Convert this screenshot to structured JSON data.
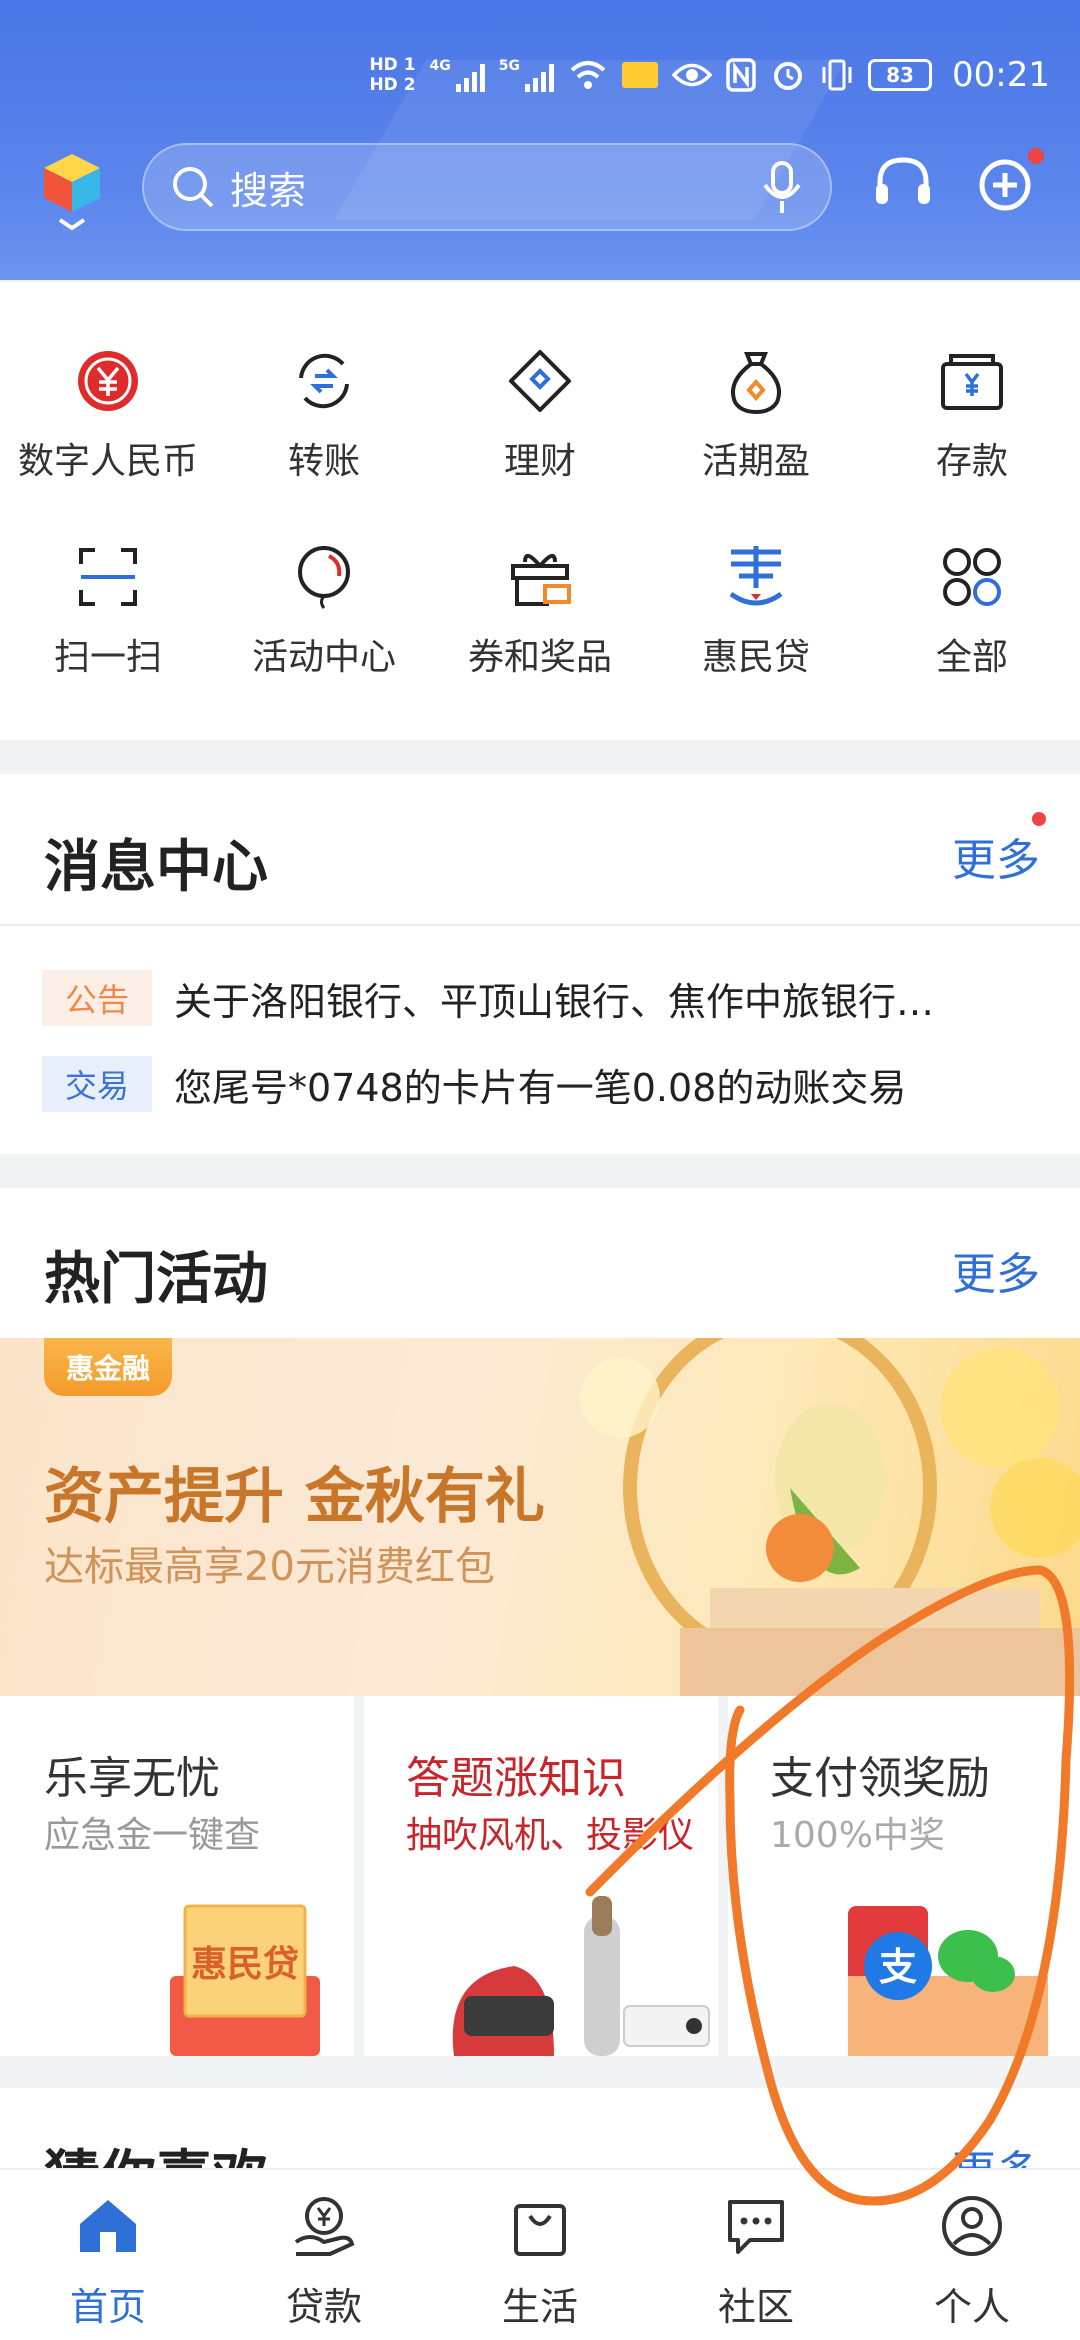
{
  "status_bar": {
    "hd1": "HD 1",
    "hd2": "HD 2",
    "net1": "4G",
    "net2": "5G",
    "battery": "83",
    "time": "00:21"
  },
  "header": {
    "search_placeholder": "搜索"
  },
  "quick_actions": [
    {
      "label": "数字人民币",
      "icon": "digital-rmb-icon"
    },
    {
      "label": "转账",
      "icon": "transfer-icon"
    },
    {
      "label": "理财",
      "icon": "wealth-diamond-icon"
    },
    {
      "label": "活期盈",
      "icon": "money-bag-icon"
    },
    {
      "label": "存款",
      "icon": "deposit-box-icon"
    },
    {
      "label": "扫一扫",
      "icon": "scan-icon"
    },
    {
      "label": "活动中心",
      "icon": "balloon-icon"
    },
    {
      "label": "券和奖品",
      "icon": "gift-icon"
    },
    {
      "label": "惠民贷",
      "icon": "huiminloan-icon"
    },
    {
      "label": "全部",
      "icon": "all-apps-icon"
    }
  ],
  "messages": {
    "title": "消息中心",
    "more": "更多",
    "items": [
      {
        "tag": "公告",
        "text": "关于洛阳银行、平顶山银行、焦作中旅银行…"
      },
      {
        "tag": "交易",
        "text": "您尾号*0748的卡片有一笔0.08的动账交易"
      }
    ]
  },
  "activities": {
    "title": "热门活动",
    "more": "更多",
    "banner": {
      "badge": "惠金融",
      "headline": "资产提升 金秋有礼",
      "subline": "达标最高享20元消费红包"
    },
    "cards": [
      {
        "title": "乐享无忧",
        "subtitle": "应急金一键查",
        "image_text": "惠民贷"
      },
      {
        "title": "答题涨知识",
        "subtitle": "抽吹风机、投影仪"
      },
      {
        "title": "支付领奖励",
        "subtitle": "100%中奖",
        "image_text": "支"
      }
    ]
  },
  "guess": {
    "title": "猜你喜欢",
    "more": "更多"
  },
  "nav": [
    {
      "label": "首页",
      "icon": "home-icon",
      "active": true
    },
    {
      "label": "贷款",
      "icon": "loan-icon",
      "active": false
    },
    {
      "label": "生活",
      "icon": "shopping-bag-icon",
      "active": false
    },
    {
      "label": "社区",
      "icon": "chat-icon",
      "active": false
    },
    {
      "label": "个人",
      "icon": "person-icon",
      "active": false
    }
  ],
  "colors": {
    "brand_blue": "#4a76e6",
    "link_blue": "#2e6fd8",
    "accent_red": "#e02b2b",
    "annotation_orange": "#f07a2a"
  }
}
